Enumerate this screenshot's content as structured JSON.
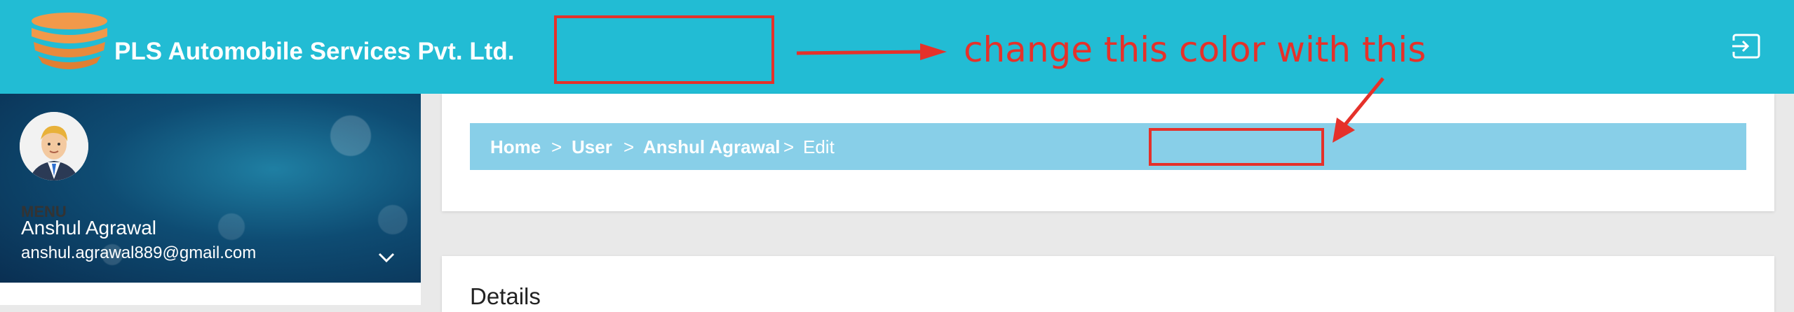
{
  "header": {
    "brand": "PLS Automobile Services Pvt. Ltd.",
    "bg_color": "#22bcd4",
    "logout_icon": "logout-icon"
  },
  "sidebar": {
    "user_name": "Anshul Agrawal",
    "user_email": "anshul.agrawal889@gmail.com",
    "menu_label": "MENU"
  },
  "breadcrumb": {
    "items": [
      "Home",
      "User",
      "Anshul Agrawal",
      "Edit"
    ],
    "separator": ">",
    "bg_color": "#88cfe8"
  },
  "details": {
    "title": "Details"
  },
  "annotation": {
    "text": "change this color with this",
    "color": "#e5312a"
  }
}
